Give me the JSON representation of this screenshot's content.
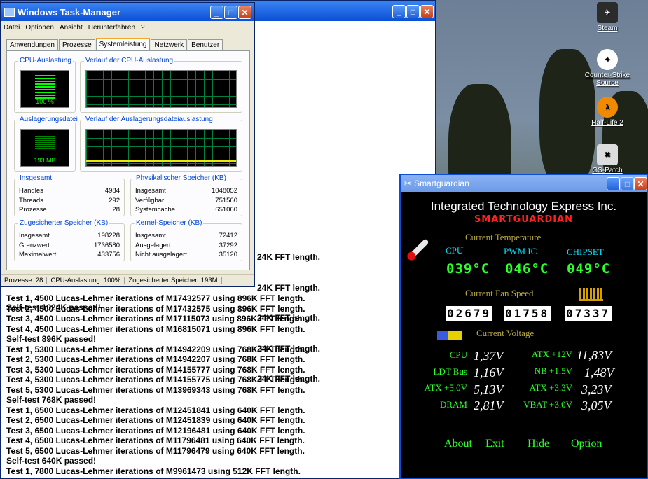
{
  "desktop": {
    "icons": [
      {
        "label": "Steam"
      },
      {
        "label": "Counter-Strike Source"
      },
      {
        "label": "Half-Life 2"
      },
      {
        "label": "GS-Patch"
      }
    ]
  },
  "console": {
    "lines": [
      "Test 1, 4500 Lucas-Lehmer iterations of M17432577 using 896K FFT length.",
      "Test 2, 4500 Lucas-Lehmer iterations of M17432575 using 896K FFT length.",
      "Test 3, 4500 Lucas-Lehmer iterations of M17115073 using 896K FFT length.",
      "Test 4, 4500 Lucas-Lehmer iterations of M16815071 using 896K FFT length.",
      "Self-test 896K passed!",
      "Test 1, 5300 Lucas-Lehmer iterations of M14942209 using 768K FFT length.",
      "Test 2, 5300 Lucas-Lehmer iterations of M14942207 using 768K FFT length.",
      "Test 3, 5300 Lucas-Lehmer iterations of M14155777 using 768K FFT length.",
      "Test 4, 5300 Lucas-Lehmer iterations of M14155775 using 768K FFT length.",
      "Test 5, 5300 Lucas-Lehmer iterations of M13969343 using 768K FFT length.",
      "Self-test 768K passed!",
      "Test 1, 6500 Lucas-Lehmer iterations of M12451841 using 640K FFT length.",
      "Test 2, 6500 Lucas-Lehmer iterations of M12451839 using 640K FFT length.",
      "Test 3, 6500 Lucas-Lehmer iterations of M12196481 using 640K FFT length.",
      "Test 4, 6500 Lucas-Lehmer iterations of M11796481 using 640K FFT length.",
      "Test 5, 6500 Lucas-Lehmer iterations of M11796479 using 640K FFT length.",
      "Self-test 640K passed!",
      "Test 1, 7800 Lucas-Lehmer iterations of M9961473 using 512K FFT length."
    ],
    "partial_lines": [
      "24K FFT length.",
      "24K FFT length.",
      "24K FFT length.",
      "24K FFT length.",
      "24K FFT length."
    ],
    "partial_self_test": "Self-test 1024K passed!"
  },
  "taskmanager": {
    "title": "Windows Task-Manager",
    "menu": [
      "Datei",
      "Optionen",
      "Ansicht",
      "Herunterfahren",
      "?"
    ],
    "tabs": [
      "Anwendungen",
      "Prozesse",
      "Systemleistung",
      "Netzwerk",
      "Benutzer"
    ],
    "active_tab": "Systemleistung",
    "cpu_group": "CPU-Auslastung",
    "cpu_history_group": "Verlauf der CPU-Auslastung",
    "cpu_value": "100 %",
    "page_group": "Auslagerungsdatei",
    "page_history_group": "Verlauf der Auslagerungsdateiauslastung",
    "page_value": "193 MB",
    "totals": {
      "title": "Insgesamt",
      "rows": [
        [
          "Handles",
          "4984"
        ],
        [
          "Threads",
          "292"
        ],
        [
          "Prozesse",
          "28"
        ]
      ]
    },
    "physical": {
      "title": "Physikalischer Speicher (KB)",
      "rows": [
        [
          "Insgesamt",
          "1048052"
        ],
        [
          "Verfügbar",
          "751560"
        ],
        [
          "Systemcache",
          "651060"
        ]
      ]
    },
    "commit": {
      "title": "Zugesicherter Speicher (KB)",
      "rows": [
        [
          "Insgesamt",
          "198228"
        ],
        [
          "Grenzwert",
          "1736580"
        ],
        [
          "Maximalwert",
          "433756"
        ]
      ]
    },
    "kernel": {
      "title": "Kernel-Speicher (KB)",
      "rows": [
        [
          "Insgesamt",
          "72412"
        ],
        [
          "Ausgelagert",
          "37292"
        ],
        [
          "Nicht ausgelagert",
          "35120"
        ]
      ]
    },
    "status": [
      "Prozesse: 28",
      "CPU-Auslastung: 100%",
      "Zugesicherter Speicher: 193M"
    ]
  },
  "smartguardian": {
    "title": "Smartguardian",
    "company": "Integrated Technology Express Inc.",
    "brand": "SMARTGUARDIAN",
    "temp_header": "Current Temperature",
    "temp_labels": [
      "CPU",
      "PWM IC",
      "CHIPSET"
    ],
    "temp_values": [
      "039°C",
      "046°C",
      "049°C"
    ],
    "fan_header": "Current Fan Speed",
    "fan_values": [
      "02679",
      "01758",
      "07337"
    ],
    "volt_header": "Current Voltage",
    "voltages": [
      {
        "label": "CPU",
        "value": "1,37V"
      },
      {
        "label": "ATX +12V",
        "value": "11,83V"
      },
      {
        "label": "LDT Bus",
        "value": "1,16V"
      },
      {
        "label": "NB +1.5V",
        "value": "1,48V"
      },
      {
        "label": "ATX +5.0V",
        "value": "5,13V"
      },
      {
        "label": "ATX +3.3V",
        "value": "3,23V"
      },
      {
        "label": "DRAM",
        "value": "2,81V"
      },
      {
        "label": "VBAT +3.0V",
        "value": "3,05V"
      }
    ],
    "buttons": [
      "About",
      "Exit",
      "Hide",
      "Option"
    ]
  },
  "colors": {
    "xp_blue": "#0a4fd6",
    "lcd_green": "#2cff2c",
    "temp_label": "#00e5ff",
    "header_olive": "#b5a642",
    "brand_red": "#ff2020"
  }
}
